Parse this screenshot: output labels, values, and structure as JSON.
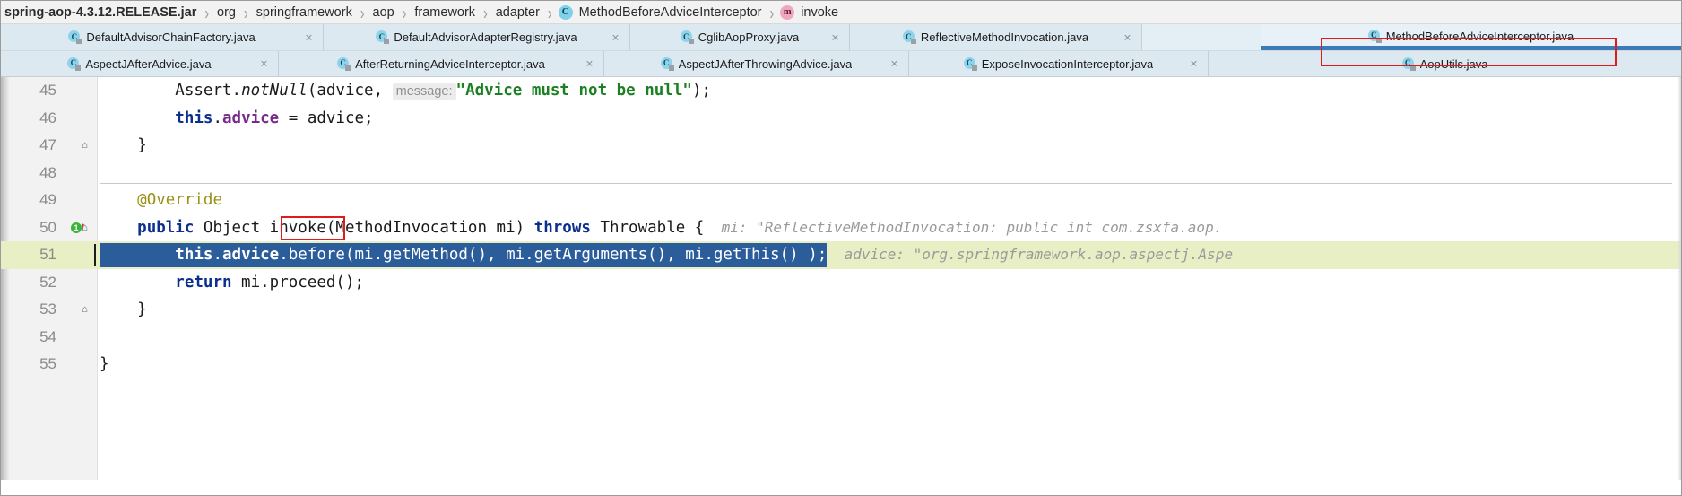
{
  "breadcrumb": {
    "items": [
      {
        "label": "spring-aop-4.3.12.RELEASE.jar",
        "bold": true,
        "badge": ""
      },
      {
        "label": "org",
        "bold": false,
        "badge": ""
      },
      {
        "label": "springframework",
        "bold": false,
        "badge": ""
      },
      {
        "label": "aop",
        "bold": false,
        "badge": ""
      },
      {
        "label": "framework",
        "bold": false,
        "badge": ""
      },
      {
        "label": "adapter",
        "bold": false,
        "badge": ""
      },
      {
        "label": "MethodBeforeAdviceInterceptor",
        "bold": false,
        "badge": "C"
      },
      {
        "label": "invoke",
        "bold": false,
        "badge": "m"
      }
    ],
    "separator": "›"
  },
  "tabs": {
    "close_glyph": "×",
    "icon_letter": "C",
    "row1": [
      {
        "label": "DefaultAdvisorChainFactory.java",
        "active": false,
        "closable": true
      },
      {
        "label": "DefaultAdvisorAdapterRegistry.java",
        "active": false,
        "closable": true
      },
      {
        "label": "CglibAopProxy.java",
        "active": false,
        "closable": true
      },
      {
        "label": "ReflectiveMethodInvocation.java",
        "active": false,
        "closable": true
      },
      {
        "label": "MethodBeforeAdviceInterceptor.java",
        "active": true,
        "closable": false
      }
    ],
    "row2": [
      {
        "label": "AspectJAfterAdvice.java",
        "active": false,
        "closable": true
      },
      {
        "label": "AfterReturningAdviceInterceptor.java",
        "active": false,
        "closable": true
      },
      {
        "label": "AspectJAfterThrowingAdvice.java",
        "active": false,
        "closable": true
      },
      {
        "label": "ExposeInvocationInterceptor.java",
        "active": false,
        "closable": true
      },
      {
        "label": "AopUtils.java",
        "active": false,
        "closable": false
      }
    ]
  },
  "editor": {
    "lines": [
      {
        "no": "45",
        "fold": "",
        "marker": ""
      },
      {
        "no": "46",
        "fold": "",
        "marker": ""
      },
      {
        "no": "47",
        "fold": "⌂",
        "marker": ""
      },
      {
        "no": "48",
        "fold": "",
        "marker": ""
      },
      {
        "no": "49",
        "fold": "",
        "marker": ""
      },
      {
        "no": "50",
        "fold": "⌂",
        "marker": "run"
      },
      {
        "no": "51",
        "fold": "",
        "marker": ""
      },
      {
        "no": "52",
        "fold": "",
        "marker": ""
      },
      {
        "no": "53",
        "fold": "⌂",
        "marker": ""
      },
      {
        "no": "54",
        "fold": "",
        "marker": ""
      },
      {
        "no": "55",
        "fold": "",
        "marker": ""
      }
    ],
    "code": {
      "l45_indent": "        ",
      "l45_assert": "Assert.",
      "l45_notnull": "notNull",
      "l45_open": "(advice, ",
      "l45_hint": "message:",
      "l45_str": "\"Advice must not be null\"",
      "l45_close": ");",
      "l46_indent": "        ",
      "l46_this": "this",
      "l46_dot": ".",
      "l46_advice": "advice",
      "l46_rest": " = advice;",
      "l47": "    }",
      "l49_indent": "    ",
      "l49_override": "@Override",
      "l50_indent": "    ",
      "l50_public": "public",
      "l50_object": " Object ",
      "l50_invoke": "invoke",
      "l50_params": "(MethodInvocation mi) ",
      "l50_throws": "throws",
      "l50_tail": " Throwable {",
      "l50_inlay_label": "mi:",
      "l50_inlay_value": "\"ReflectiveMethodInvocation: public int com.zsxfa.aop.",
      "l51_indent": "        ",
      "l51_this": "this",
      "l51_dot1": ".",
      "l51_advice": "advice",
      "l51_rest": ".before(mi.getMethod(), mi.getArguments(), mi.getThis() );",
      "l51_inlay_label": "advice:",
      "l51_inlay_value": "\"org.springframework.aop.aspectj.Aspe",
      "l52_indent": "        ",
      "l52_return": "return",
      "l52_rest": " mi.proceed();",
      "l53": "    }",
      "l55": "}"
    },
    "run_marker_badge": "1",
    "run_marker_arrow": "↑"
  },
  "colors": {
    "accent": "#3d7ab8",
    "annotation_red": "#e01b1b",
    "selection_blue": "#2c5d9b",
    "string_green": "#1a8021",
    "keyword_blue": "#0b2f8f",
    "field_purple": "#7a2a8c",
    "annotation_yellow": "#9a9014",
    "inlay_gray": "#9a9a9a"
  }
}
